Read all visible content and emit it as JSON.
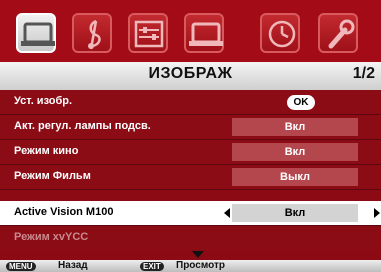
{
  "menu": {
    "title": "ИЗОБРАЖ",
    "page": "1/2"
  },
  "icons": [
    "picture-icon",
    "music-note-icon",
    "setup-icon",
    "tv-screen-icon",
    "clock-icon",
    "wrench-icon"
  ],
  "rows": [
    {
      "label": "Уст. изобр.",
      "badge": "OK"
    },
    {
      "label": "Акт. регул. лампы подсв.",
      "value": "Вкл"
    },
    {
      "label": "Режим кино",
      "value": "Вкл"
    },
    {
      "label": "Режим Фильм",
      "value": "Выкл"
    },
    {
      "label": "Active Vision M100",
      "value": "Вкл"
    },
    {
      "label": "Режим xvYCC"
    }
  ],
  "footer": {
    "menu_key": "MENU",
    "menu_label": "Назад",
    "exit_key": "EXIT",
    "exit_label": "Просмотр"
  }
}
